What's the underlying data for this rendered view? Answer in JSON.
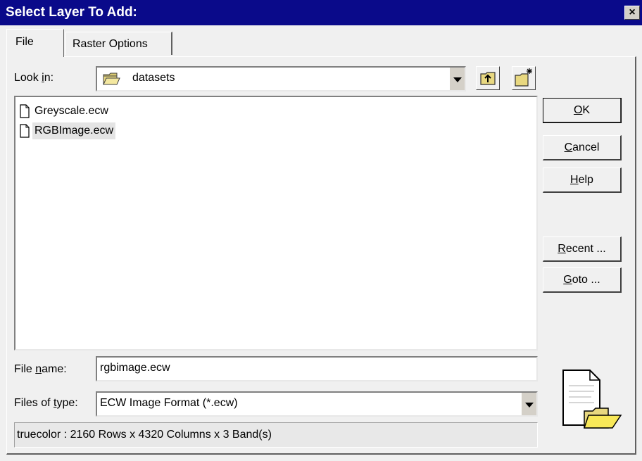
{
  "window": {
    "title": "Select Layer To Add:",
    "close_label": "×"
  },
  "tabs": [
    {
      "label": "File"
    },
    {
      "label": "Raster Options"
    }
  ],
  "look_in": {
    "label_pre": "Look ",
    "label_ul": "i",
    "label_post": "n:",
    "value": "datasets",
    "icon": "folder-icon"
  },
  "toolbar": {
    "up_icon": "folder-up-icon",
    "new_icon": "new-folder-icon"
  },
  "files": [
    {
      "name": "Greyscale.ecw",
      "icon": "file-icon",
      "selected": false
    },
    {
      "name": "RGBImage.ecw",
      "icon": "file-icon",
      "selected": true
    }
  ],
  "buttons": {
    "ok": {
      "ul": "O",
      "rest": "K"
    },
    "cancel": {
      "ul": "C",
      "rest": "ancel"
    },
    "help": {
      "ul": "H",
      "rest": "elp"
    },
    "recent": {
      "ul": "R",
      "rest": "ecent ..."
    },
    "goto": {
      "ul": "G",
      "rest": "oto ..."
    }
  },
  "file_name": {
    "label_pre": "File ",
    "label_ul": "n",
    "label_post": "ame:",
    "value": "rgbimage.ecw"
  },
  "file_type": {
    "label_pre": "Files of ",
    "label_ul": "t",
    "label_post": "ype:",
    "value": "ECW Image Format (*.ecw)"
  },
  "status": "truecolor : 2160 Rows x 4320 Columns x 3 Band(s)",
  "colors": {
    "titlebar": "#0a0a8a",
    "face": "#f0f0f0",
    "selection": "#e4e4e4"
  }
}
